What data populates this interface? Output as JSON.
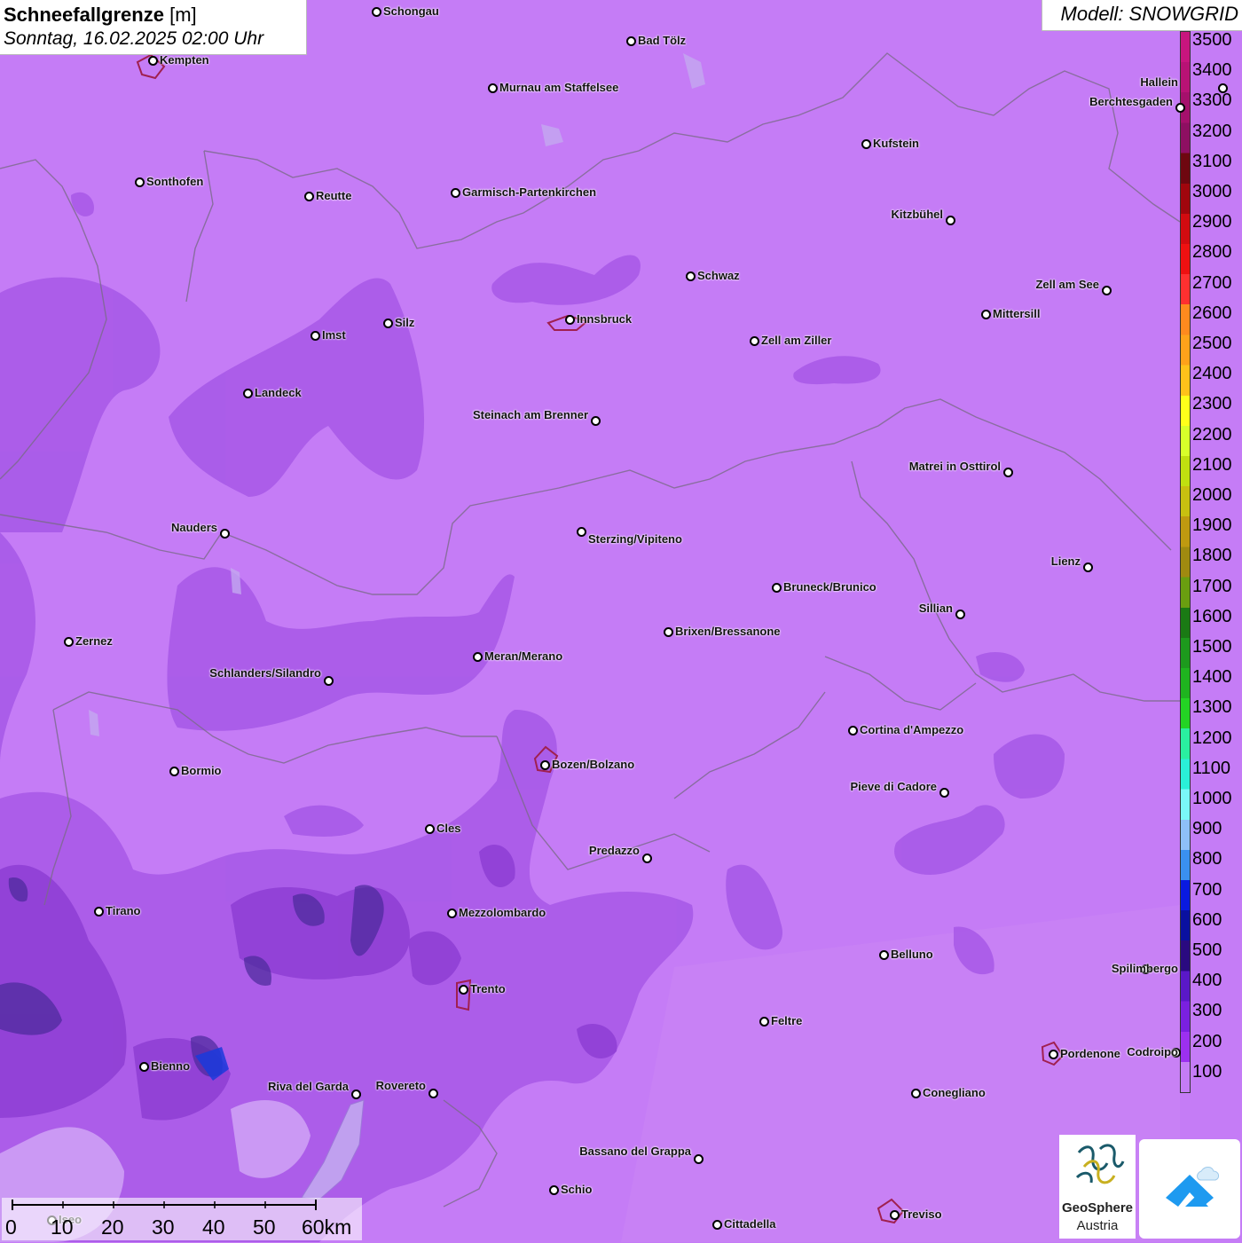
{
  "title": {
    "variable": "Schneefallgrenze",
    "unit": "[m]",
    "datetime": "Sonntag, 16.02.2025 02:00 Uhr"
  },
  "model_label": "Modell: SNOWGRID",
  "legend": {
    "values": [
      "3500",
      "3400",
      "3300",
      "3200",
      "3100",
      "3000",
      "2900",
      "2800",
      "2700",
      "2600",
      "2500",
      "2400",
      "2300",
      "2200",
      "2100",
      "2000",
      "1900",
      "1800",
      "1700",
      "1600",
      "1500",
      "1400",
      "1300",
      "1200",
      "1100",
      "1000",
      "900",
      "800",
      "700",
      "600",
      "500",
      "400",
      "300",
      "200",
      "100"
    ],
    "colors": [
      "#c8157e",
      "#b81275",
      "#a5106c",
      "#8e0f62",
      "#6e0710",
      "#a0060d",
      "#d20b10",
      "#ee1111",
      "#ff3030",
      "#ff8a1e",
      "#ffa21a",
      "#ffc21a",
      "#ffff1a",
      "#d8ff2a",
      "#c0e010",
      "#c8c010",
      "#bf9a10",
      "#a08a10",
      "#6a9e10",
      "#1a7a14",
      "#1d9a1d",
      "#1fb41f",
      "#24d424",
      "#2af0a0",
      "#2af0d8",
      "#7af8f8",
      "#8ec0f8",
      "#3a90f0",
      "#0a1ae0",
      "#0a10a0",
      "#2a0a80",
      "#5a18c8",
      "#7a20e0",
      "#9c30f0",
      "#c57cf6"
    ]
  },
  "cities": [
    {
      "name": "Schongau"
    },
    {
      "name": "Bad Tölz"
    },
    {
      "name": "Kempten"
    },
    {
      "name": "Murnau am Staffelsee"
    },
    {
      "name": "Hallein"
    },
    {
      "name": "Berchtesgaden"
    },
    {
      "name": "Kufstein"
    },
    {
      "name": "Sonthofen"
    },
    {
      "name": "Reutte"
    },
    {
      "name": "Garmisch-Partenkirchen"
    },
    {
      "name": "Kitzbühel"
    },
    {
      "name": "Schwaz"
    },
    {
      "name": "Zell am See"
    },
    {
      "name": "Innsbruck"
    },
    {
      "name": "Mittersill"
    },
    {
      "name": "Imst"
    },
    {
      "name": "Silz"
    },
    {
      "name": "Zell am Ziller"
    },
    {
      "name": "Landeck"
    },
    {
      "name": "Steinach am Brenner"
    },
    {
      "name": "Matrei in Osttirol"
    },
    {
      "name": "Nauders"
    },
    {
      "name": "Sterzing/Vipiteno"
    },
    {
      "name": "Lienz"
    },
    {
      "name": "Bruneck/Brunico"
    },
    {
      "name": "Sillian"
    },
    {
      "name": "Zernez"
    },
    {
      "name": "Brixen/Bressanone"
    },
    {
      "name": "Meran/Merano"
    },
    {
      "name": "Schlanders/Silandro"
    },
    {
      "name": "Cortina d'Ampezzo"
    },
    {
      "name": "Bormio"
    },
    {
      "name": "Bozen/Bolzano"
    },
    {
      "name": "Pieve di Cadore"
    },
    {
      "name": "Cles"
    },
    {
      "name": "Predazzo"
    },
    {
      "name": "Tirano"
    },
    {
      "name": "Mezzolombardo"
    },
    {
      "name": "Belluno"
    },
    {
      "name": "Spilimbergo"
    },
    {
      "name": "Trento"
    },
    {
      "name": "Feltre"
    },
    {
      "name": "Bienno"
    },
    {
      "name": "Pordenone"
    },
    {
      "name": "Codroipo"
    },
    {
      "name": "Riva del Garda"
    },
    {
      "name": "Rovereto"
    },
    {
      "name": "Conegliano"
    },
    {
      "name": "Bassano del Grappa"
    },
    {
      "name": "Schio"
    },
    {
      "name": "Iseo"
    },
    {
      "name": "Treviso"
    },
    {
      "name": "Cittadella"
    }
  ],
  "scale_bar": {
    "labels": [
      "0",
      "10",
      "20",
      "30",
      "40",
      "50",
      "60km"
    ]
  },
  "logos": {
    "geosphere_line1": "GeoSphere",
    "geosphere_line2": "Austria"
  }
}
